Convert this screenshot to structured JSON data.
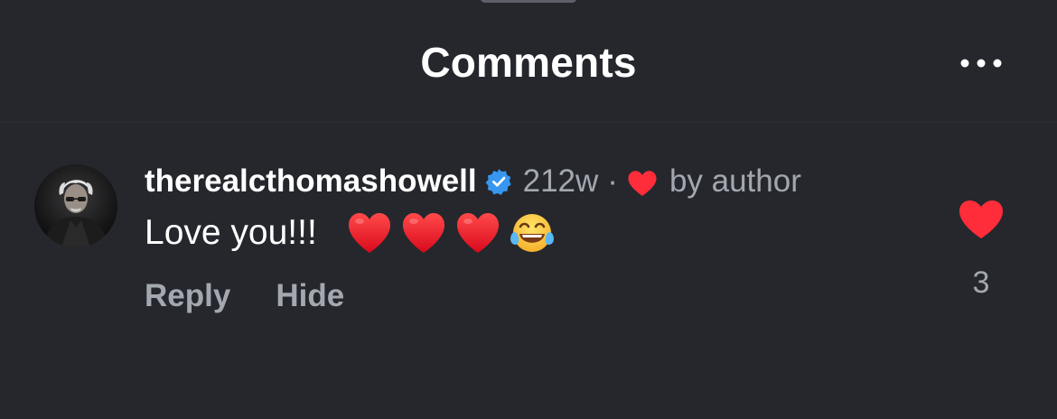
{
  "header": {
    "title": "Comments",
    "more_icon": "ellipsis-icon"
  },
  "comment": {
    "avatar_icon": "user-avatar",
    "username": "therealcthomashowell",
    "verified_icon": "verified-badge-icon",
    "timestamp": "212w",
    "separator": "·",
    "liked_by_icon": "heart-icon",
    "liked_by_text": "by author",
    "text": "Love you!!!",
    "emojis": [
      "red-heart",
      "red-heart",
      "red-heart",
      "face-with-tears-of-joy"
    ],
    "reply_label": "Reply",
    "hide_label": "Hide",
    "like_icon": "heart-icon",
    "like_count": "3"
  },
  "colors": {
    "background": "#25272d",
    "verified": "#3797f0",
    "heart": "#ff2d3a",
    "secondary_text": "#a3a8b0"
  }
}
